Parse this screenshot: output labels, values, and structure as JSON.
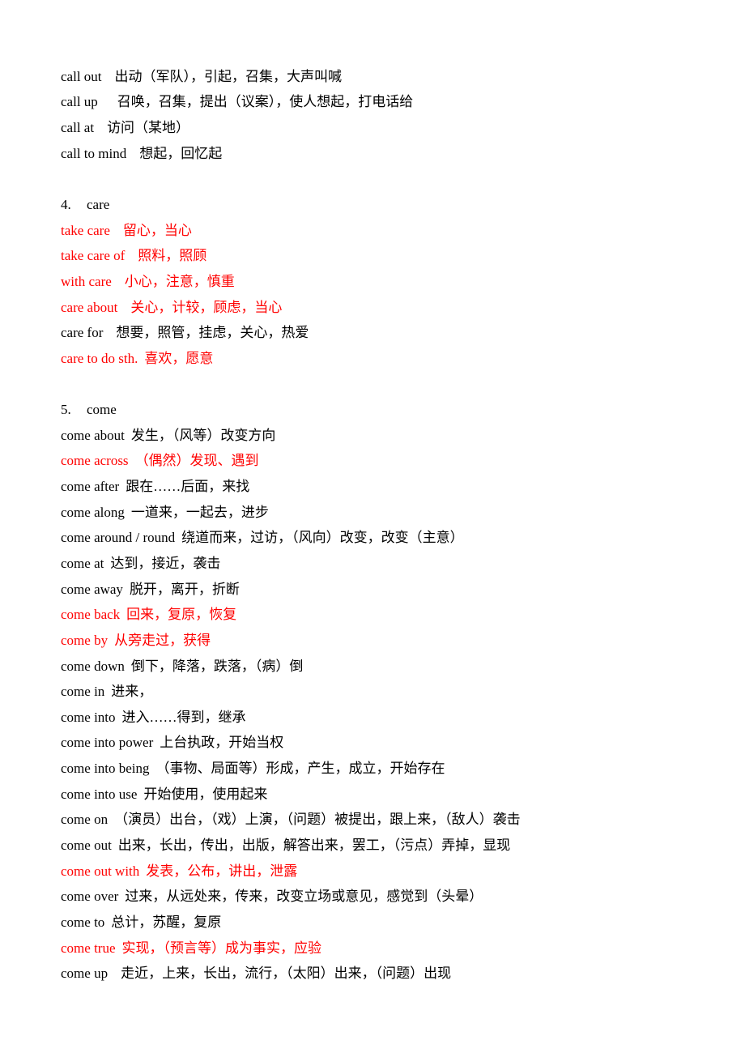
{
  "document": {
    "sections": [
      {
        "heading": null,
        "entries": [
          {
            "term": "call out",
            "gap": 2,
            "definition": "出动（军队），引起，召集，大声叫喊",
            "highlight": false
          },
          {
            "term": "call up",
            "gap": 3,
            "definition": "召唤，召集，提出（议案），使人想起，打电话给",
            "highlight": false
          },
          {
            "term": "call at",
            "gap": 2,
            "definition": "访问（某地）",
            "highlight": false
          },
          {
            "term": "call to mind",
            "gap": 2,
            "definition": "想起，回忆起",
            "highlight": false
          }
        ]
      },
      {
        "heading": {
          "number": "4.",
          "word": "care"
        },
        "entries": [
          {
            "term": "take care",
            "gap": 2,
            "definition": "留心，当心",
            "highlight": true
          },
          {
            "term": "take care of",
            "gap": 2,
            "definition": "照料，照顾",
            "highlight": true
          },
          {
            "term": "with care",
            "gap": 2,
            "definition": "小心，注意，慎重",
            "highlight": true
          },
          {
            "term": "care about",
            "gap": 2,
            "definition": "关心，计较，顾虑，当心",
            "highlight": true
          },
          {
            "term": "care for",
            "gap": 2,
            "definition": "想要，照管，挂虑，关心，热爱",
            "highlight": false
          },
          {
            "term": "care to do sth.",
            "gap": 1,
            "definition": "喜欢，愿意",
            "highlight": true
          }
        ]
      },
      {
        "heading": {
          "number": "5.",
          "word": "come"
        },
        "entries": [
          {
            "term": "come about",
            "gap": 1,
            "definition": "发生，（风等）改变方向",
            "highlight": false
          },
          {
            "term": "come across",
            "gap": 1,
            "definition": "（偶然）发现、遇到",
            "highlight": true
          },
          {
            "term": "come after",
            "gap": 1,
            "definition": "跟在……后面，来找",
            "highlight": false
          },
          {
            "term": "come along",
            "gap": 1,
            "definition": "一道来，一起去，进步",
            "highlight": false
          },
          {
            "term": "come around / round",
            "gap": 1,
            "definition": "绕道而来，过访，（风向）改变，改变（主意）",
            "highlight": false
          },
          {
            "term": "come at",
            "gap": 1,
            "definition": "达到，接近，袭击",
            "highlight": false
          },
          {
            "term": "come away",
            "gap": 1,
            "definition": "脱开，离开，折断",
            "highlight": false
          },
          {
            "term": "come back",
            "gap": 1,
            "definition": "回来，复原，恢复",
            "highlight": true
          },
          {
            "term": "come by",
            "gap": 1,
            "definition": "从旁走过，获得",
            "highlight": true
          },
          {
            "term": "come down",
            "gap": 1,
            "definition": "倒下，降落，跌落，（病）倒",
            "highlight": false
          },
          {
            "term": "come in",
            "gap": 1,
            "definition": "进来，",
            "highlight": false
          },
          {
            "term": "come into",
            "gap": 1,
            "definition": "进入……得到，继承",
            "highlight": false
          },
          {
            "term": "come into power",
            "gap": 1,
            "definition": "上台执政，开始当权",
            "highlight": false
          },
          {
            "term": "come into being",
            "gap": 1,
            "definition": "（事物、局面等）形成，产生，成立，开始存在",
            "highlight": false
          },
          {
            "term": "come into use",
            "gap": 1,
            "definition": "开始使用，使用起来",
            "highlight": false
          },
          {
            "term": "come on",
            "gap": 1,
            "definition": "（演员）出台，（戏）上演，（问题）被提出，跟上来，（敌人）袭击",
            "highlight": false
          },
          {
            "term": "come out",
            "gap": 1,
            "definition": "出来，长出，传出，出版，解答出来，罢工，（污点）弄掉，显现",
            "highlight": false
          },
          {
            "term": "come out with",
            "gap": 1,
            "definition": "发表，公布，讲出，泄露",
            "highlight": true
          },
          {
            "term": "come over",
            "gap": 1,
            "definition": "过来，从远处来，传来，改变立场或意见，感觉到（头晕）",
            "highlight": false
          },
          {
            "term": "come to",
            "gap": 1,
            "definition": "总计，苏醒，复原",
            "highlight": false
          },
          {
            "term": "come true",
            "gap": 1,
            "definition": "实现，（预言等）成为事实，应验",
            "highlight": true
          },
          {
            "term": "come up",
            "gap": 2,
            "definition": "走近，上来，长出，流行，（太阳）出来，（问题）出现",
            "highlight": false
          }
        ]
      }
    ],
    "colors": {
      "text": "#000000",
      "highlight": "#ff0000"
    }
  }
}
